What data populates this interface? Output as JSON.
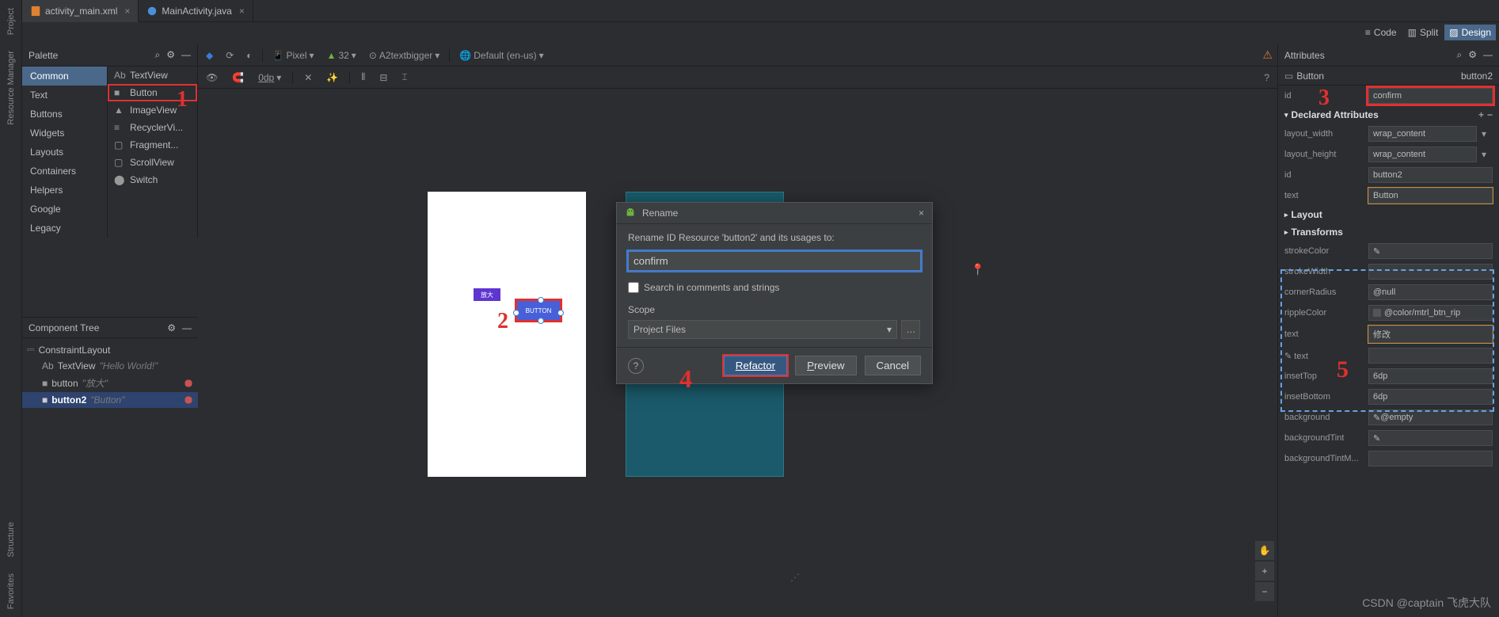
{
  "tabs": [
    {
      "name": "activity_main.xml",
      "icon_color": "#e08030",
      "active": true
    },
    {
      "name": "MainActivity.java",
      "icon_color": "#4a90d9",
      "active": false
    }
  ],
  "view_modes": {
    "code": "Code",
    "split": "Split",
    "design": "Design"
  },
  "palette": {
    "title": "Palette",
    "categories": [
      "Common",
      "Text",
      "Buttons",
      "Widgets",
      "Layouts",
      "Containers",
      "Helpers",
      "Google",
      "Legacy"
    ],
    "items": [
      {
        "label": "TextView",
        "prefix": "Ab",
        "hl": false
      },
      {
        "label": "Button",
        "prefix": "■",
        "hl": true
      },
      {
        "label": "ImageView",
        "prefix": "▲",
        "hl": false
      },
      {
        "label": "RecyclerVi...",
        "prefix": "≡",
        "hl": false
      },
      {
        "label": "Fragment...",
        "prefix": "▢",
        "hl": false
      },
      {
        "label": "ScrollView",
        "prefix": "▢",
        "hl": false
      },
      {
        "label": "Switch",
        "prefix": "⬤",
        "hl": false
      }
    ]
  },
  "design_toolbar": {
    "device": "Pixel",
    "api": "32",
    "theme": "A2textbigger",
    "locale": "Default (en-us)",
    "dp": "0dp"
  },
  "device_preview": {
    "small_btn_text": "放大",
    "sel_btn_text": "BUTTON"
  },
  "component_tree": {
    "title": "Component Tree",
    "root": "ConstraintLayout",
    "children": [
      {
        "name": "TextView",
        "sub": "\"Hello World!\"",
        "err": false,
        "prefix": "Ab"
      },
      {
        "name": "button",
        "sub": "\"放大\"",
        "err": true,
        "prefix": "■"
      },
      {
        "name": "button2",
        "sub": "\"Button\"",
        "err": true,
        "sel": true,
        "prefix": "■"
      }
    ]
  },
  "rename_dialog": {
    "title": "Rename",
    "message": "Rename ID Resource 'button2' and its usages to:",
    "value": "confirm",
    "check_label": "Search in comments and strings",
    "scope_label": "Scope",
    "scope_value": "Project Files",
    "refactor": "Refactor",
    "preview": "Preview",
    "cancel": "Cancel"
  },
  "attributes": {
    "title": "Attributes",
    "type": "Button",
    "instance": "button2",
    "id_label": "id",
    "id_value": "confirm",
    "declared": {
      "title": "Declared Attributes",
      "rows": [
        {
          "label": "layout_width",
          "value": "wrap_content",
          "dd": true
        },
        {
          "label": "layout_height",
          "value": "wrap_content",
          "dd": true
        },
        {
          "label": "id",
          "value": "button2"
        },
        {
          "label": "text",
          "value": "Button",
          "orange": true
        }
      ]
    },
    "layout_section": "Layout",
    "transforms_section": "Transforms",
    "extra_rows": [
      {
        "label": "strokeColor",
        "value": "",
        "picker": true
      },
      {
        "label": "strokeWidth",
        "value": ""
      },
      {
        "label": "cornerRadius",
        "value": "@null"
      },
      {
        "label": "rippleColor",
        "value": "@color/mtrl_btn_rip",
        "picker": true
      },
      {
        "label": "text",
        "value": "修改",
        "orange": true,
        "hl": true
      },
      {
        "label": "✎ text",
        "value": ""
      },
      {
        "label": "insetTop",
        "value": "6dp"
      },
      {
        "label": "insetBottom",
        "value": "6dp"
      },
      {
        "label": "background",
        "value": "@empty",
        "picker": true
      },
      {
        "label": "backgroundTint",
        "value": "",
        "picker": true
      },
      {
        "label": "backgroundTintM...",
        "value": ""
      }
    ]
  },
  "rail": {
    "project": "Project",
    "res_mgr": "Resource Manager",
    "structure": "Structure",
    "favorites": "Favorites"
  },
  "annotations": {
    "a1": "1",
    "a2": "2",
    "a3": "3",
    "a4": "4",
    "a5": "5"
  },
  "watermark": "CSDN @captain 飞虎大队"
}
